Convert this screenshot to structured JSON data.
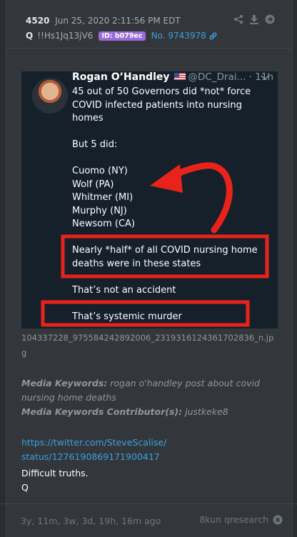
{
  "post": {
    "number": "4520",
    "datetime": "Jun 25, 2020 2:11:56 PM EDT",
    "author": "Q",
    "tripcode": "!!Hs1Jq13jV6",
    "id_badge": "ID: b079ec",
    "post_no": "No. 9743978",
    "colors": {
      "badge": "#9b6bd6",
      "link": "#3aa0e0"
    }
  },
  "tweet": {
    "name": "Rogan O’Handley",
    "handle": "@DC_Drai... · 11h",
    "lines": {
      "l1": "45 out of 50 Governors did *not* force COVID infected patients into nursing homes",
      "l2": "But 5 did:",
      "s1": "Cuomo (NY)",
      "s2": "Wolf (PA)",
      "s3": "Whitmer (MI)",
      "s4": "Murphy (NJ)",
      "s5": "Newsom (CA)",
      "l3": "Nearly *half* of all COVID nursing home deaths were in these states",
      "l4": "That’s not an accident",
      "l5": "That’s systemic murder"
    },
    "annotation_color": "#e8231b"
  },
  "filename": "104337228_975584242892006_2319316124361702836_n.jpg",
  "media": {
    "keywords_label": "Media Keywords:",
    "keywords": "rogan o'handley post about covid nursing home deaths",
    "contrib_label": "Media Keywords Contributor(s):",
    "contrib": "justkeke8"
  },
  "link": {
    "line1": "https://twitter.com/SteveScalise/",
    "line2": "status/1276190869171900417"
  },
  "message": {
    "line1": "Difficult truths.",
    "line2": "Q"
  },
  "footer": {
    "age": "3y, 11m, 3w, 3d, 19h, 16m ago",
    "source": "8kun qresearch"
  },
  "icons": [
    "share-icon",
    "download-icon",
    "arrow-right-icon",
    "link-icon",
    "close-icon",
    "chevron-down-icon"
  ]
}
